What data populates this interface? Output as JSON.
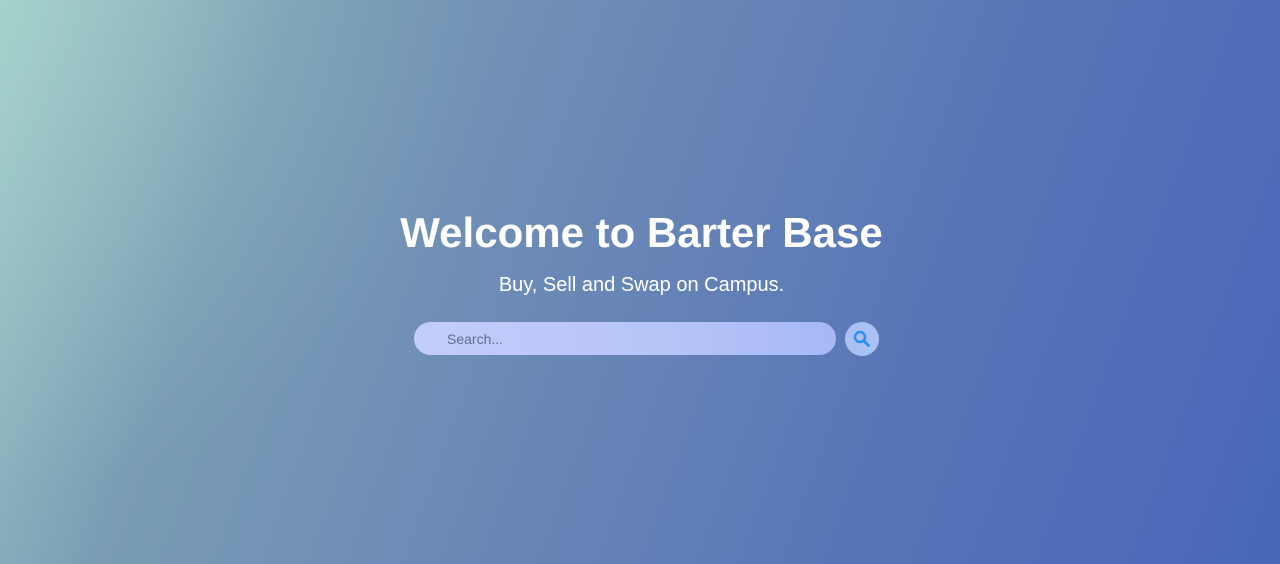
{
  "hero": {
    "title": "Welcome to Barter Base",
    "subtitle": "Buy, Sell and Swap on Campus."
  },
  "search": {
    "placeholder": "Search...",
    "value": "",
    "button_icon": "search-icon"
  },
  "colors": {
    "search_icon": "#2b8ef2",
    "search_button_bg": "#a9c1f5",
    "text": "#ffffff"
  }
}
